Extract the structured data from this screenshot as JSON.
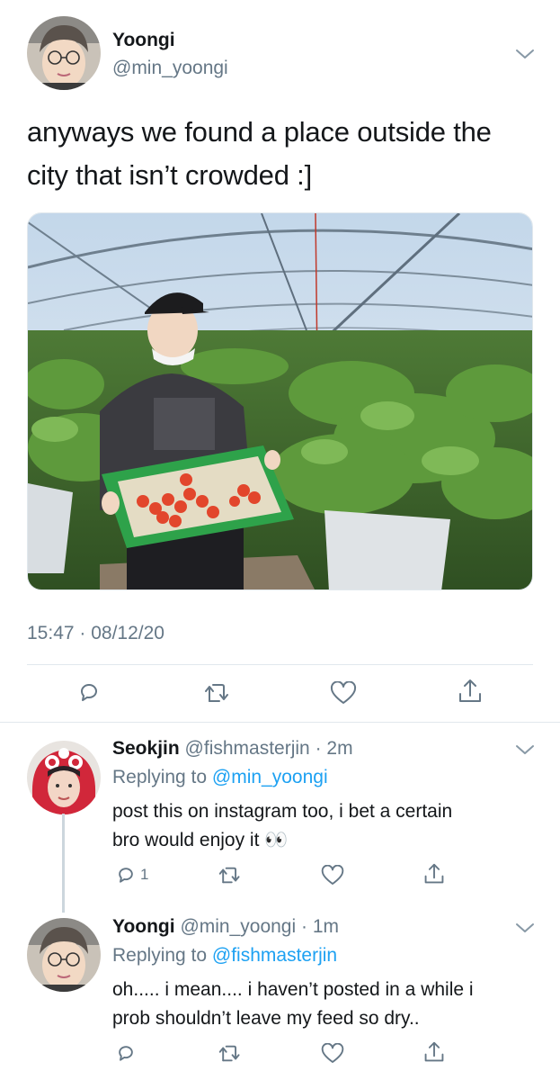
{
  "main_tweet": {
    "author_name": "Yoongi",
    "author_handle": "@min_yoongi",
    "text_line1": "anyways we found a place outside the",
    "text_line2": "city that isn’t crowded :]",
    "timestamp": "15:47 · 08/12/20"
  },
  "replies": [
    {
      "author_name": "Seokjin",
      "author_handle": "@fishmasterjin",
      "time": "· 2m",
      "replying_prefix": "Replying to ",
      "replying_to": "@min_yoongi",
      "text_line1": "post this on instagram too, i bet a certain",
      "text_line2": "bro would enjoy it 👀",
      "reply_count": "1"
    },
    {
      "author_name": "Yoongi",
      "author_handle": "@min_yoongi",
      "time": "· 1m",
      "replying_prefix": "Replying to ",
      "replying_to": "@fishmasterjin",
      "text_line1": "oh..... i mean.... i haven’t posted in a while i",
      "text_line2": "prob shouldn’t leave my feed so dry..",
      "reply_count": ""
    }
  ],
  "icons": {
    "reply": "reply-icon",
    "retweet": "retweet-icon",
    "like": "heart-icon",
    "share": "share-icon",
    "menu": "chevron-down-icon"
  },
  "colors": {
    "link": "#1da1f2",
    "secondary_text": "#657786",
    "divider": "#e1e8ed"
  }
}
